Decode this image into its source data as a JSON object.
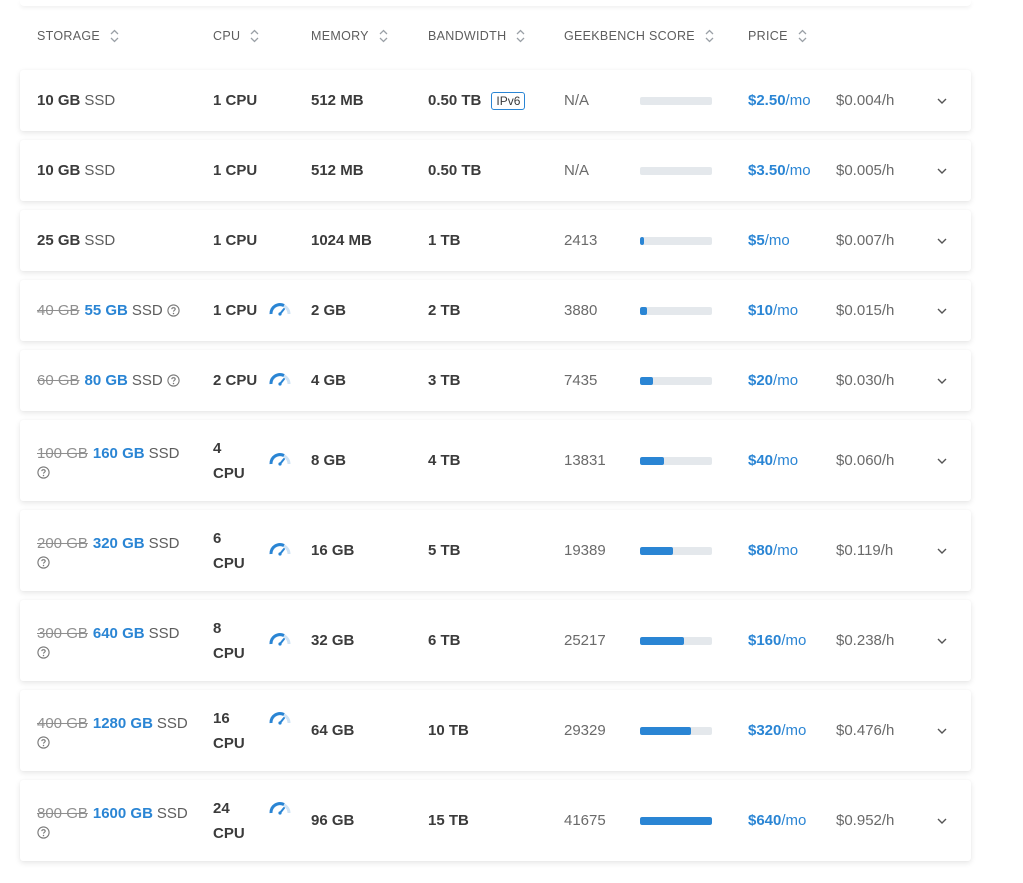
{
  "colors": {
    "accent": "#2a85d4",
    "bar_track": "#e4e8ec",
    "text": "#3b3b3b"
  },
  "header": {
    "storage": "STORAGE",
    "cpu": "CPU",
    "memory": "MEMORY",
    "bandwidth": "BANDWIDTH",
    "geekbench": "GEEKBENCH SCORE",
    "price": "PRICE"
  },
  "plans": [
    {
      "storage_old": "",
      "storage_size": "10 GB",
      "storage_type": "SSD",
      "help": false,
      "cpu_num": "1",
      "cpu_unit": "CPU",
      "boost": false,
      "memory": "512 MB",
      "bandwidth": "0.50 TB",
      "badge": "IPv6",
      "score": "N/A",
      "score_value": 0,
      "price": "$2.50",
      "price_unit": "/mo",
      "hourly": "$0.004/h"
    },
    {
      "storage_old": "",
      "storage_size": "10 GB",
      "storage_type": "SSD",
      "help": false,
      "cpu_num": "1",
      "cpu_unit": "CPU",
      "boost": false,
      "memory": "512 MB",
      "bandwidth": "0.50 TB",
      "badge": "",
      "score": "N/A",
      "score_value": 0,
      "price": "$3.50",
      "price_unit": "/mo",
      "hourly": "$0.005/h"
    },
    {
      "storage_old": "",
      "storage_size": "25 GB",
      "storage_type": "SSD",
      "help": false,
      "cpu_num": "1",
      "cpu_unit": "CPU",
      "boost": false,
      "memory": "1024 MB",
      "bandwidth": "1 TB",
      "badge": "",
      "score": "2413",
      "score_value": 2413,
      "price": "$5",
      "price_unit": "/mo",
      "hourly": "$0.007/h"
    },
    {
      "storage_old": "40 GB",
      "storage_size": "55 GB",
      "storage_type": "SSD",
      "help": true,
      "cpu_num": "1",
      "cpu_unit": "CPU",
      "boost": true,
      "memory": "2 GB",
      "bandwidth": "2 TB",
      "badge": "",
      "score": "3880",
      "score_value": 3880,
      "price": "$10",
      "price_unit": "/mo",
      "hourly": "$0.015/h"
    },
    {
      "storage_old": "60 GB",
      "storage_size": "80 GB",
      "storage_type": "SSD",
      "help": true,
      "cpu_num": "2",
      "cpu_unit": "CPU",
      "boost": true,
      "memory": "4 GB",
      "bandwidth": "3 TB",
      "badge": "",
      "score": "7435",
      "score_value": 7435,
      "price": "$20",
      "price_unit": "/mo",
      "hourly": "$0.030/h"
    },
    {
      "storage_old": "100 GB",
      "storage_size": "160 GB",
      "storage_type": "SSD",
      "help": true,
      "cpu_num": "4",
      "cpu_unit": "CPU",
      "boost": true,
      "memory": "8 GB",
      "bandwidth": "4 TB",
      "badge": "",
      "score": "13831",
      "score_value": 13831,
      "price": "$40",
      "price_unit": "/mo",
      "hourly": "$0.060/h"
    },
    {
      "storage_old": "200 GB",
      "storage_size": "320 GB",
      "storage_type": "SSD",
      "help": true,
      "cpu_num": "6",
      "cpu_unit": "CPU",
      "boost": true,
      "memory": "16 GB",
      "bandwidth": "5 TB",
      "badge": "",
      "score": "19389",
      "score_value": 19389,
      "price": "$80",
      "price_unit": "/mo",
      "hourly": "$0.119/h"
    },
    {
      "storage_old": "300 GB",
      "storage_size": "640 GB",
      "storage_type": "SSD",
      "help": true,
      "cpu_num": "8",
      "cpu_unit": "CPU",
      "boost": true,
      "memory": "32 GB",
      "bandwidth": "6 TB",
      "badge": "",
      "score": "25217",
      "score_value": 25217,
      "price": "$160",
      "price_unit": "/mo",
      "hourly": "$0.238/h"
    },
    {
      "storage_old": "400 GB",
      "storage_size": "1280 GB",
      "storage_type": "SSD",
      "help": true,
      "cpu_num": "16",
      "cpu_unit": "CPU",
      "boost": true,
      "memory": "64 GB",
      "bandwidth": "10 TB",
      "badge": "",
      "score": "29329",
      "score_value": 29329,
      "price": "$320",
      "price_unit": "/mo",
      "hourly": "$0.476/h"
    },
    {
      "storage_old": "800 GB",
      "storage_size": "1600 GB",
      "storage_type": "SSD",
      "help": true,
      "cpu_num": "24",
      "cpu_unit": "CPU",
      "boost": true,
      "memory": "96 GB",
      "bandwidth": "15 TB",
      "badge": "",
      "score": "41675",
      "score_value": 41675,
      "price": "$640",
      "price_unit": "/mo",
      "hourly": "$0.952/h"
    }
  ]
}
